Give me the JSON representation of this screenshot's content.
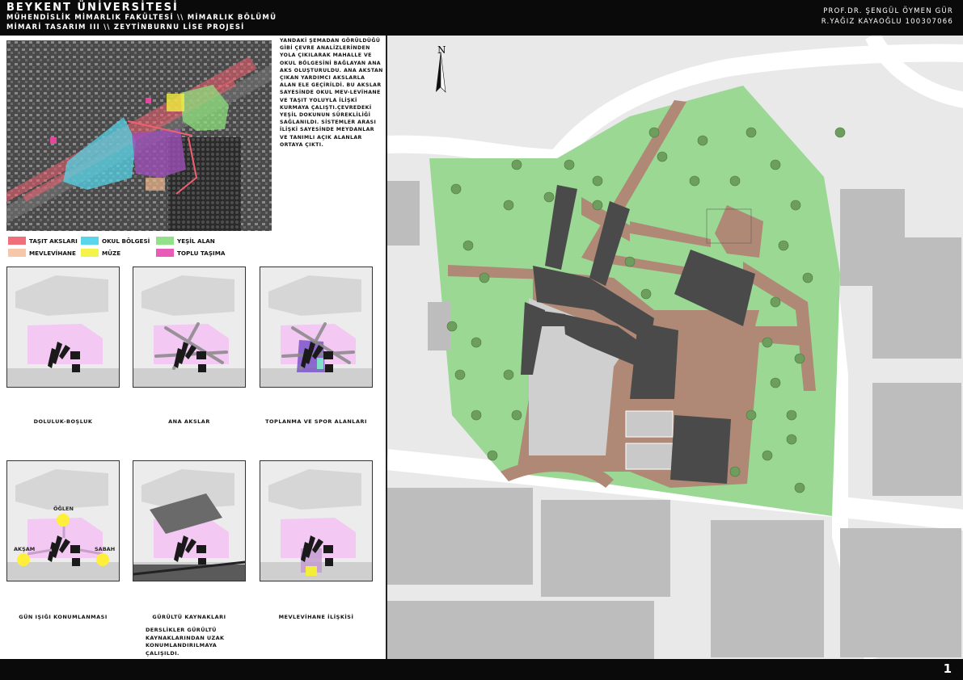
{
  "header": {
    "university": "BEYKENT ÜNİVERSİTESİ",
    "faculty_line": "MÜHENDİSLİK MİMARLIK FAKÜLTESİ \\\\ MİMARLIK BÖLÜMÜ",
    "course_line": "MİMARİ TASARIM III \\\\ ZEYTİNBURNU LİSE PROJESİ",
    "professor": "PROF.DR. ŞENGÜL ÖYMEN GÜR",
    "student": "R.YAĞIZ KAYAOĞLU 100307066"
  },
  "description": "YANDAKİ ŞEMADAN GÖRÜLDÜĞÜ GİBİ ÇEVRE ANALİZLERİNDEN YOLA ÇIKILARAK MAHALLE VE OKUL BÖLGESİNİ BAĞLAYAN ANA AKS OLUŞTURULDU. ANA AKSTAN ÇIKAN YARDIMCI AKSLARLA ALAN ELE GEÇİRİLDİ. BU AKSLAR SAYESİNDE OKUL MEV-LEVİHANE VE TAŞIT YOLUYLA İLİŞKİ KURMAYA ÇALIŞTI.ÇEVREDEKİ YEŞİL DOKUNUN SÜREKLİLİĞİ SAĞLANILDI. SİSTEMLER ARASI İLİŞKİ SAYESİNDE MEYDANLAR VE TANIMLI AÇIK ALANLAR ORTAYA ÇIKTI.",
  "legend": [
    {
      "label": "TAŞIT AKSLARI",
      "color": "#f0707a"
    },
    {
      "label": "OKUL BÖLGESİ",
      "color": "#5ad6ec"
    },
    {
      "label": "YEŞİL ALAN",
      "color": "#93e08a"
    },
    {
      "label": "MEVLEVİHANE",
      "color": "#f6c7a8"
    },
    {
      "label": "MÜZE",
      "color": "#f3f34a"
    },
    {
      "label": "TOPLU TAŞIMA",
      "color": "#e85cb8"
    }
  ],
  "diagrams": [
    {
      "caption": "DOLULUK-BOŞLUK"
    },
    {
      "caption": "ANA AKSLAR"
    },
    {
      "caption": "TOPLANMA VE SPOR ALANLARI"
    },
    {
      "caption": "GÜN IŞIĞI KONUMLANMASI"
    },
    {
      "caption": "GÜRÜLTÜ KAYNAKLARI"
    },
    {
      "caption": "MEVLEVİHANE İLİŞKİSİ"
    }
  ],
  "sun_labels": {
    "noon": "ÖĞLEN",
    "evening": "AKŞAM",
    "morning": "SABAH"
  },
  "noise_note": "DERSLİKLER GÜRÜLTÜ KAYNAKLARINDAN UZAK KONUMLANDIRILMAYA ÇALIŞILDI.",
  "north_label": "N",
  "page_number": "1",
  "colors": {
    "green": "#9ad894",
    "path": "#b08876",
    "building": "#4a4a4a",
    "school_zone": "#f3c8f3"
  }
}
